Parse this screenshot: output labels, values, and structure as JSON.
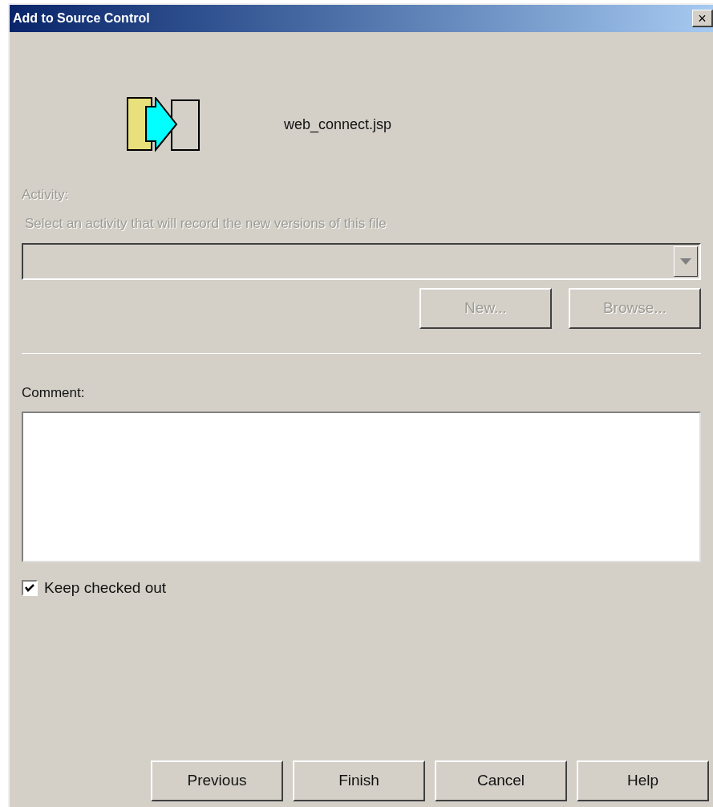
{
  "window": {
    "title": "Add to Source Control",
    "close": "×"
  },
  "file": {
    "name": "web_connect.jsp"
  },
  "activity": {
    "label": "Activity:",
    "hint": "Select an activity that will record the new versions of this file",
    "disabled": true,
    "buttons": [
      {
        "label": "New...",
        "disabled": true
      },
      {
        "label": "Browse...",
        "disabled": true
      }
    ]
  },
  "comment": {
    "label": "Comment:"
  },
  "keep_checked_out": {
    "label": "Keep checked out",
    "checked": true
  },
  "buttons": [
    {
      "label": "Previous"
    },
    {
      "label": "Finish"
    },
    {
      "label": "Cancel"
    },
    {
      "label": "Help"
    }
  ]
}
